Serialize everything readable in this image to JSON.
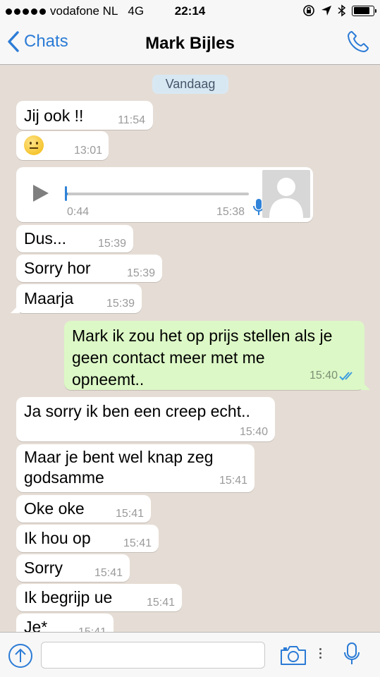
{
  "status_bar": {
    "carrier": "vodafone NL",
    "network": "4G",
    "time": "22:14",
    "battery_level": 0.85
  },
  "nav": {
    "back_label": "Chats",
    "contact_name": "Mark Bijles"
  },
  "chat": {
    "date_separator": "Vandaag",
    "voice_message": {
      "duration": "0:44",
      "time": "15:38",
      "progress": 0.01
    },
    "messages": [
      {
        "text": "Jij ook !!",
        "time": "11:54",
        "dir": "in"
      },
      {
        "text": "",
        "time": "13:01",
        "dir": "in",
        "emoji": "slightly-smiling-face"
      },
      {
        "text": "Dus...",
        "time": "15:39",
        "dir": "in"
      },
      {
        "text": "Sorry hor",
        "time": "15:39",
        "dir": "in"
      },
      {
        "text": "Maarja",
        "time": "15:39",
        "dir": "in"
      },
      {
        "lines": [
          "Mark ik zou het op prijs stellen als je",
          "geen contact meer met me",
          "opneemt.."
        ],
        "time": "15:40",
        "dir": "out",
        "read": true
      },
      {
        "text": "Ja sorry ik ben een creep echt..",
        "time": "15:40",
        "dir": "in"
      },
      {
        "lines": [
          "Maar je bent wel knap zeg",
          "godsamme"
        ],
        "time": "15:41",
        "dir": "in"
      },
      {
        "text": "Oke oke",
        "time": "15:41",
        "dir": "in"
      },
      {
        "text": "Ik hou op",
        "time": "15:41",
        "dir": "in"
      },
      {
        "text": "Sorry",
        "time": "15:41",
        "dir": "in"
      },
      {
        "text": "Ik begrijp ue",
        "time": "15:41",
        "dir": "in"
      },
      {
        "text": "Je*",
        "time": "15:41",
        "dir": "in"
      }
    ]
  },
  "input": {
    "placeholder": "",
    "value": ""
  },
  "colors": {
    "accent": "#2b7bd6",
    "incoming_bubble": "#ffffff",
    "outgoing_bubble": "#dcf8c6",
    "chat_background": "#e5ddd5"
  }
}
